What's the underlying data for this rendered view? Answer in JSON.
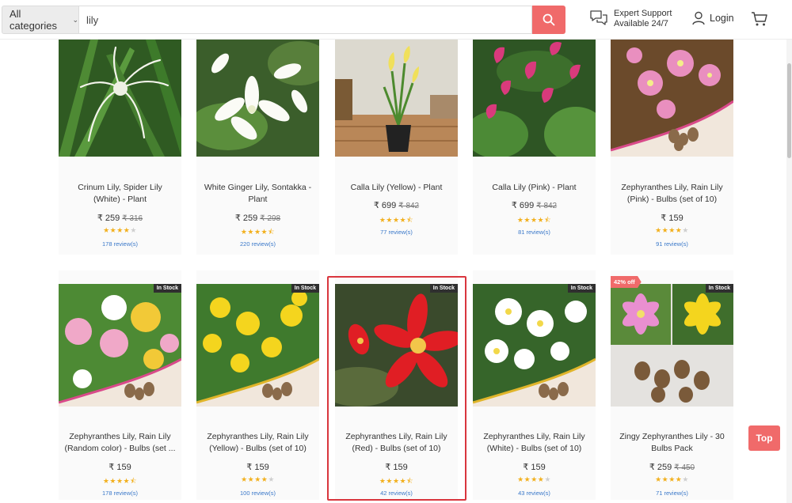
{
  "header": {
    "category_label": "All categories",
    "search_value": "lily",
    "support_title": "Expert Support",
    "support_subtitle": "Available 24/7",
    "login_label": "Login"
  },
  "colors": {
    "accent": "#f06a6a",
    "star": "#f2b01e",
    "link": "#3a78c9",
    "selection": "#d9363e"
  },
  "products": [
    {
      "name": "Crinum Lily, Spider Lily (White) - Plant",
      "price": "₹ 259",
      "old_price": "₹ 316",
      "rating": 4,
      "reviews": "178 review(s)",
      "badge": "",
      "discount": ""
    },
    {
      "name": "White Ginger Lily, Sontakka - Plant",
      "price": "₹ 259",
      "old_price": "₹ 298",
      "rating": 4.5,
      "reviews": "220 review(s)",
      "badge": "",
      "discount": ""
    },
    {
      "name": "Calla Lily (Yellow) - Plant",
      "price": "₹ 699",
      "old_price": "₹ 842",
      "rating": 4.5,
      "reviews": "77 review(s)",
      "badge": "",
      "discount": ""
    },
    {
      "name": "Calla Lily (Pink) - Plant",
      "price": "₹ 699",
      "old_price": "₹ 842",
      "rating": 4.5,
      "reviews": "81 review(s)",
      "badge": "",
      "discount": ""
    },
    {
      "name": "Zephyranthes Lily, Rain Lily (Pink) - Bulbs (set of 10)",
      "price": "₹ 159",
      "old_price": "",
      "rating": 4,
      "reviews": "91 review(s)",
      "badge": "",
      "discount": ""
    },
    {
      "name": "Zephyranthes Lily, Rain Lily (Random color) - Bulbs (set ...",
      "price": "₹ 159",
      "old_price": "",
      "rating": 4.5,
      "reviews": "178 review(s)",
      "badge": "In Stock",
      "discount": ""
    },
    {
      "name": "Zephyranthes Lily, Rain Lily (Yellow) - Bulbs (set of 10)",
      "price": "₹ 159",
      "old_price": "",
      "rating": 4,
      "reviews": "100 review(s)",
      "badge": "In Stock",
      "discount": ""
    },
    {
      "name": "Zephyranthes Lily, Rain Lily (Red) - Bulbs (set of 10)",
      "price": "₹ 159",
      "old_price": "",
      "rating": 4.5,
      "reviews": "42 review(s)",
      "badge": "In Stock",
      "discount": ""
    },
    {
      "name": "Zephyranthes Lily, Rain Lily (White) - Bulbs (set of 10)",
      "price": "₹ 159",
      "old_price": "",
      "rating": 4,
      "reviews": "43 review(s)",
      "badge": "In Stock",
      "discount": ""
    },
    {
      "name": "Zingy Zephyranthes Lily - 30 Bulbs Pack",
      "price": "₹ 259",
      "old_price": "₹ 450",
      "rating": 4,
      "reviews": "71 review(s)",
      "badge": "In Stock",
      "discount": "42% off"
    }
  ],
  "top_button": "Top"
}
